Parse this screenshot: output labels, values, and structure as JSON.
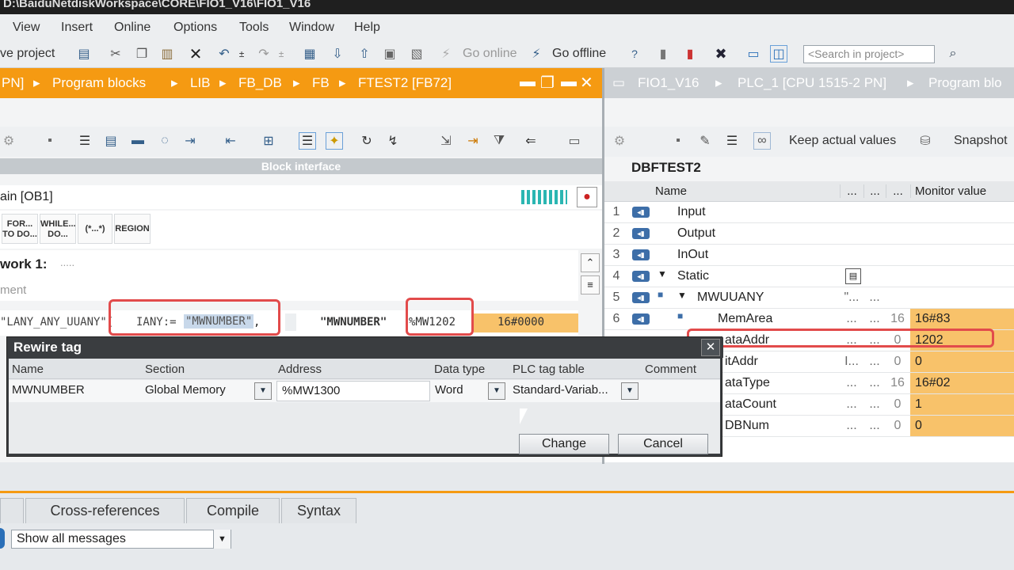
{
  "window": {
    "title": "D:\\BaiduNetdiskWorkspace\\CORE\\FIO1_V16\\FIO1_V16"
  },
  "menu": [
    "View",
    "Insert",
    "Online",
    "Options",
    "Tools",
    "Window",
    "Help"
  ],
  "toolbar": {
    "save_project": "ve project",
    "go_online": "Go online",
    "go_offline": "Go offline",
    "search_placeholder": "<Search in project>"
  },
  "breadcrumb_left": {
    "items": [
      "PN]",
      "Program blocks",
      "LIB",
      "FB_DB",
      "FB",
      "FTEST2 [FB72]"
    ]
  },
  "breadcrumb_right": {
    "items": [
      "FIO1_V16",
      "PLC_1 [CPU 1515-2 PN]",
      "Program blo"
    ]
  },
  "editor": {
    "block_interface": "Block interface",
    "main_block": "ain [OB1]",
    "instructions": [
      {
        "label": "FOR...\nTO DO..."
      },
      {
        "label": "WHILE...\nDO..."
      },
      {
        "label": "(*...*)"
      },
      {
        "label": "REGION"
      }
    ],
    "network_title": "work 1:",
    "network_dots": ".....",
    "comment_placeholder": "ment",
    "code": {
      "call": "\"LANY_ANY_UUANY\"(",
      "param": "IANY:=",
      "param_value": "\"MWNUMBER\"",
      "comma": ",",
      "tag_name": "\"MWNUMBER\"",
      "tag_address": "%MW1202",
      "tag_value": "16#0000"
    }
  },
  "monitor": {
    "keep_actual": "Keep actual values",
    "snapshot": "Snapshot",
    "db_title": "DBFTEST2",
    "columns": {
      "name": "Name",
      "c1": "...",
      "c2": "...",
      "c3": "...",
      "monitor": "Monitor value"
    },
    "rows": [
      {
        "num": "1",
        "name": "Input",
        "c1": "",
        "c2": "",
        "c3": "",
        "value": ""
      },
      {
        "num": "2",
        "name": "Output",
        "c1": "",
        "c2": "",
        "c3": "",
        "value": ""
      },
      {
        "num": "3",
        "name": "InOut",
        "c1": "",
        "c2": "",
        "c3": "",
        "value": ""
      },
      {
        "num": "4",
        "name": "Static",
        "c1": "",
        "c2": "",
        "c3": "",
        "value": ""
      },
      {
        "num": "5",
        "name": "MWUUANY",
        "c1": "\"...",
        "c2": "...",
        "c3": "",
        "value": ""
      },
      {
        "num": "6",
        "name": "MemArea",
        "c1": "...",
        "c2": "...",
        "c3": "16",
        "value": "16#83"
      },
      {
        "num": "",
        "name": "ataAddr",
        "c1": "...",
        "c2": "...",
        "c3": "0",
        "value": "1202"
      },
      {
        "num": "",
        "name": "itAddr",
        "c1": "I...",
        "c2": "...",
        "c3": "0",
        "value": "0"
      },
      {
        "num": "",
        "name": "ataType",
        "c1": "...",
        "c2": "...",
        "c3": "16",
        "value": "16#02"
      },
      {
        "num": "",
        "name": "ataCount",
        "c1": "...",
        "c2": "...",
        "c3": "0",
        "value": "1"
      },
      {
        "num": "",
        "name": "DBNum",
        "c1": "...",
        "c2": "...",
        "c3": "0",
        "value": "0"
      }
    ]
  },
  "dialog": {
    "title": "Rewire tag",
    "columns": {
      "name": "Name",
      "section": "Section",
      "address": "Address",
      "data_type": "Data type",
      "tag_table": "PLC tag table",
      "comment": "Comment"
    },
    "row": {
      "name": "MWNUMBER",
      "section": "Global Memory",
      "address": "%MW1300",
      "data_type": "Word",
      "tag_table": "Standard-Variab..."
    },
    "change_label": "Change",
    "cancel_label": "Cancel"
  },
  "bottom": {
    "tabs": [
      "Cross-references",
      "Compile",
      "Syntax"
    ],
    "filter_value": "Show all messages"
  },
  "colors": {
    "accent": "#f59a12",
    "monitor_highlight": "#f8c26a",
    "annotation": "#e24b4b"
  }
}
